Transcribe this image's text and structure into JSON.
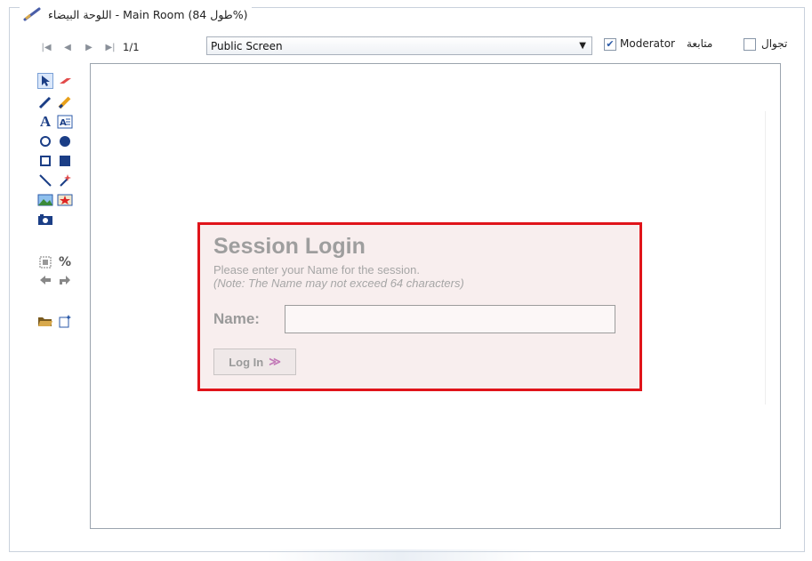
{
  "window": {
    "title": "اللوحة البيضاء - Main Room (طول 84%)"
  },
  "toolbar": {
    "first_page": "|◀",
    "prev_page": "◀",
    "next_page": "▶",
    "last_page": "▶|",
    "page_indicator": "1/1",
    "screen_select": {
      "selected": "Public Screen"
    },
    "moderator": {
      "label": "Moderator",
      "checked": true
    },
    "follow": {
      "label": "متابعة"
    },
    "roam": {
      "label": "تجوال",
      "checked": false
    }
  },
  "tools": [
    {
      "name": "pointer-tool",
      "icon": "arrow-icon"
    },
    {
      "name": "eraser-tool",
      "icon": "eraser-icon"
    },
    {
      "name": "pen-tool",
      "icon": "pen-icon"
    },
    {
      "name": "highlighter-tool",
      "icon": "highlighter-icon"
    },
    {
      "name": "text-tool",
      "icon": "text-icon"
    },
    {
      "name": "text-box-tool",
      "icon": "text-box-icon"
    },
    {
      "name": "circle-outline-tool",
      "icon": "circle-outline-icon"
    },
    {
      "name": "circle-filled-tool",
      "icon": "circle-filled-icon"
    },
    {
      "name": "rect-outline-tool",
      "icon": "rect-outline-icon"
    },
    {
      "name": "rect-filled-tool",
      "icon": "rect-filled-icon"
    },
    {
      "name": "line-tool",
      "icon": "line-icon"
    },
    {
      "name": "magic-tool",
      "icon": "magic-wand-icon"
    },
    {
      "name": "image-tool",
      "icon": "image-icon"
    },
    {
      "name": "stamp-tool",
      "icon": "stamp-icon"
    },
    {
      "name": "camera-tool",
      "icon": "camera-icon"
    },
    {
      "name": "select-all-tool",
      "icon": "select-all-icon"
    },
    {
      "name": "percent-tool",
      "icon": "percent-icon"
    },
    {
      "name": "undo-tool",
      "icon": "undo-icon"
    },
    {
      "name": "redo-tool",
      "icon": "redo-icon"
    },
    {
      "name": "open-tool",
      "icon": "folder-icon"
    },
    {
      "name": "new-tool",
      "icon": "new-doc-icon"
    }
  ],
  "login": {
    "title": "Session Login",
    "subtitle": "Please enter your Name for the session.",
    "note": "(Note: The Name may not exceed 64 characters)",
    "name_label": "Name:",
    "name_value": "",
    "button_label": "Log In",
    "button_icon": "double-chevron-right-icon"
  },
  "colors": {
    "login_border": "#e0141a",
    "login_bg": "#f8eeee"
  }
}
